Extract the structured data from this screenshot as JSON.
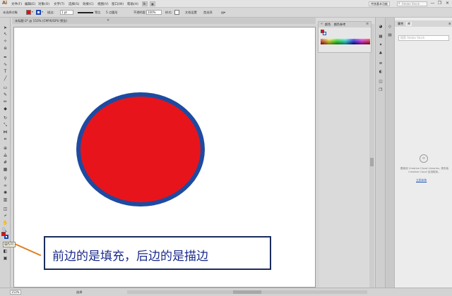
{
  "app": {
    "logo": "Ai",
    "menu": [
      "文件(F)",
      "编辑(E)",
      "对象(O)",
      "文字(T)",
      "选择(S)",
      "效果(C)",
      "视图(V)",
      "窗口(W)",
      "帮助(H)"
    ],
    "sync_label": "传统基本功能",
    "search_placeholder": "Adobe Stock",
    "window_controls": [
      "—",
      "❐",
      "✕"
    ]
  },
  "control_bar": {
    "selection_label": "未选择对象",
    "stroke_label": "描边:",
    "stroke_value": "1 pt",
    "stroke_profile": "等比",
    "brush_label": "5 点圆形",
    "opacity_label": "不透明度:",
    "opacity_value": "100%",
    "style_label": "样式:",
    "doc_setup_button": "文档设置",
    "preferences_button": "首选项"
  },
  "document": {
    "tab_label": "未标题-2* @ 153% (CMYK/GPU 预览)",
    "shape": {
      "fill_color": "#e8141c",
      "stroke_color": "#1e4aa0"
    }
  },
  "toolbar": {
    "tools": [
      "selection-tool",
      "direct-selection-tool",
      "magic-wand-tool",
      "lasso-tool",
      "pen-tool",
      "curvature-tool",
      "type-tool",
      "line-tool",
      "rectangle-tool",
      "paintbrush-tool",
      "pencil-tool",
      "eraser-tool",
      "rotate-tool",
      "scale-tool",
      "width-tool",
      "free-transform-tool",
      "shape-builder-tool",
      "perspective-tool",
      "mesh-tool",
      "gradient-tool",
      "eyedropper-tool",
      "blend-tool",
      "symbol-sprayer-tool",
      "column-graph-tool",
      "artboard-tool",
      "slice-tool",
      "hand-tool",
      "zoom-tool"
    ],
    "fill_color": "#ff0000",
    "stroke_color": "#1e45b0",
    "tooltip": "填色(X)"
  },
  "color_panel": {
    "title": "颜色",
    "tab_label": "颜色参考"
  },
  "libraries_panel": {
    "tabs": [
      "属性",
      "库"
    ],
    "search_placeholder": "搜索 Adobe Stock",
    "message": "要使用 Creative Cloud Libraries, 请安装 Creative Cloud 应用程序。",
    "link": "立即安装"
  },
  "status_bar": {
    "zoom": "153%",
    "tool_label": "选择"
  },
  "annotation": {
    "text": "前边的是填充，后边的是描边",
    "line_color": "#e07b1d",
    "text_color": "#1a2a8c"
  }
}
